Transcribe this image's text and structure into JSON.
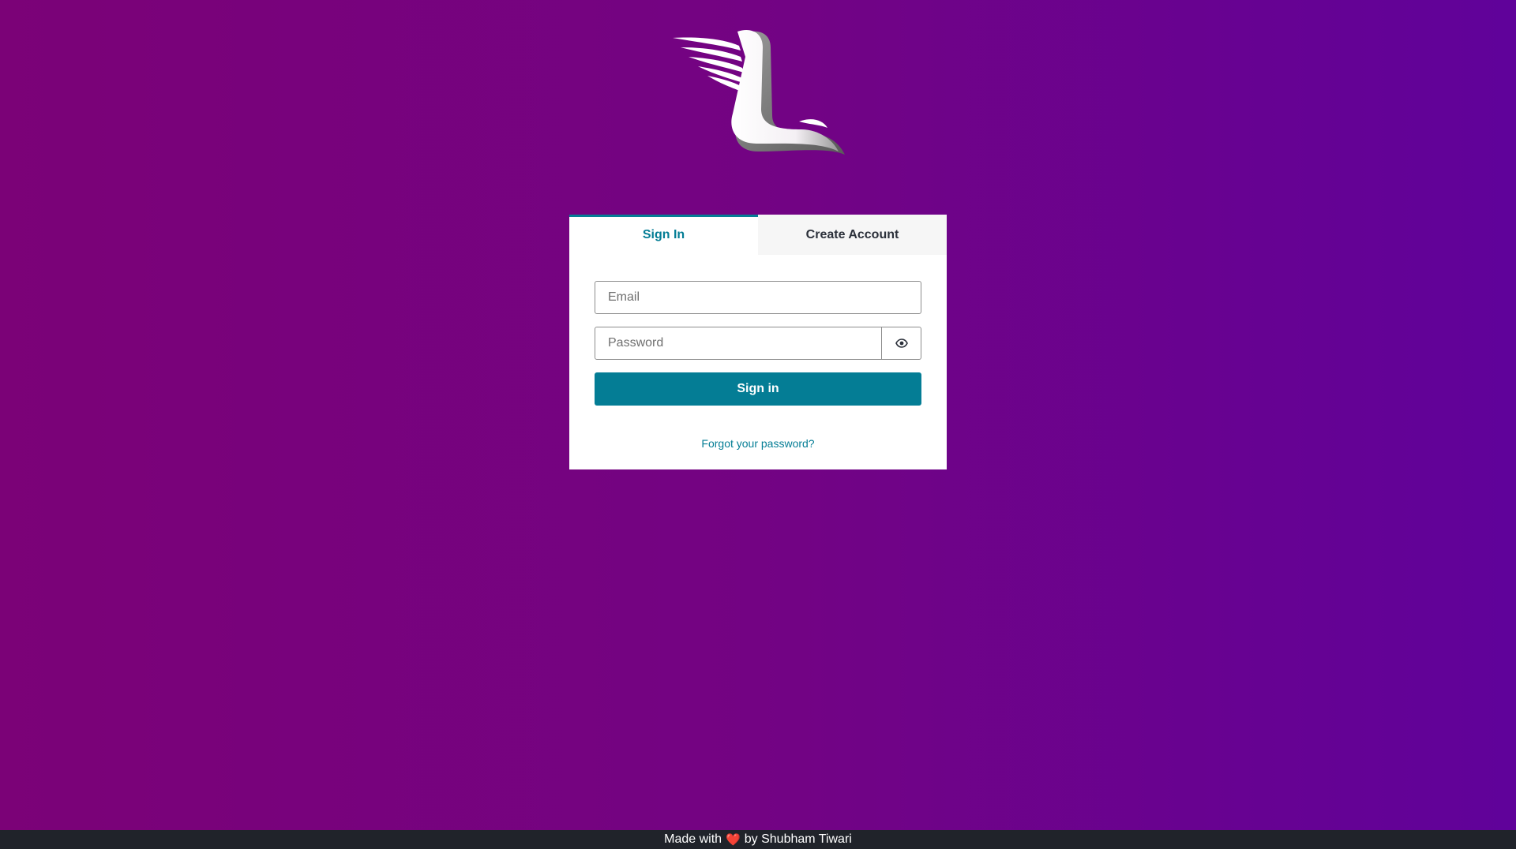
{
  "logo": {
    "icon": "winged-l-logo"
  },
  "auth": {
    "tabs": [
      {
        "label": "Sign In",
        "active": true
      },
      {
        "label": "Create Account",
        "active": false
      }
    ],
    "email": {
      "placeholder": "Email",
      "value": ""
    },
    "password": {
      "placeholder": "Password",
      "value": "",
      "toggle_icon": "eye-icon"
    },
    "submit_label": "Sign in",
    "forgot_label": "Forgot your password?"
  },
  "footer": {
    "prefix": "Made with",
    "heart": "❤️",
    "suffix": "by Shubham Tiwari"
  },
  "colors": {
    "accent": "#047d95",
    "background_start": "#7b0277",
    "background_end": "#60029a",
    "footer_bg": "#20232a"
  }
}
